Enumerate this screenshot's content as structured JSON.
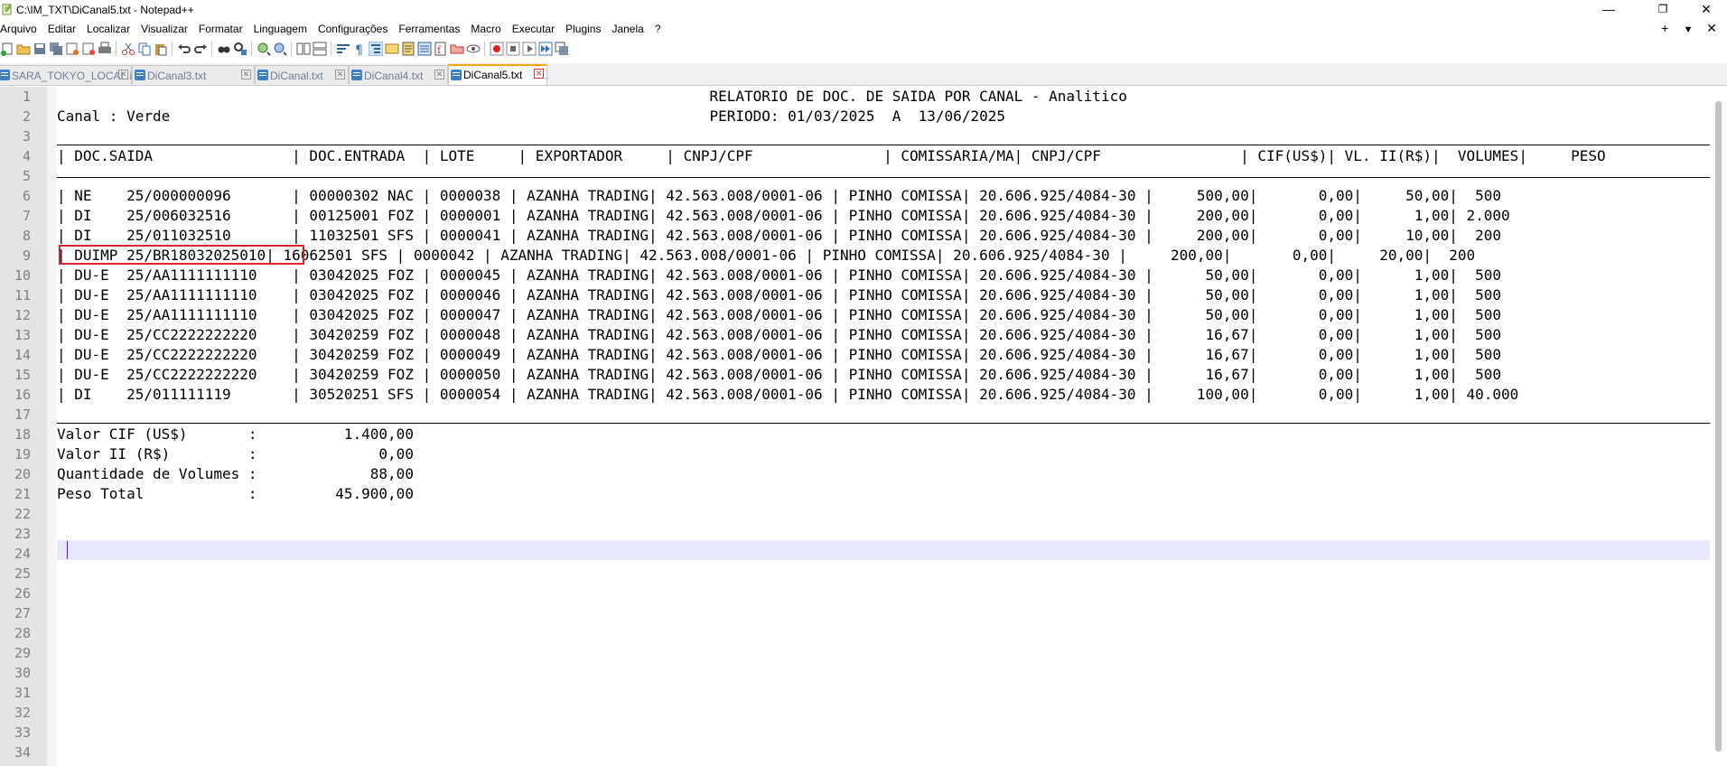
{
  "window": {
    "title": "C:\\IM_TXT\\DiCanal5.txt - Notepad++",
    "minimize": "—",
    "restore": "❐",
    "close": "✕"
  },
  "menu": {
    "items": [
      "Arquivo",
      "Editar",
      "Localizar",
      "Visualizar",
      "Formatar",
      "Linguagem",
      "Configurações",
      "Ferramentas",
      "Macro",
      "Executar",
      "Plugins",
      "Janela",
      "?"
    ],
    "right": [
      "+",
      "▼",
      "✕"
    ]
  },
  "tabs": [
    {
      "label": "SARA_TOKYO_LOCAL.ini",
      "active": false
    },
    {
      "label": "DiCanal3.txt",
      "active": false
    },
    {
      "label": "DiCanal.txt",
      "active": false
    },
    {
      "label": "DiCanal4.txt",
      "active": false
    },
    {
      "label": "DiCanal5.txt",
      "active": true
    }
  ],
  "editor": {
    "line_numbers": [
      "1",
      "2",
      "3",
      "4",
      "5",
      "6",
      "7",
      "8",
      "9",
      "10",
      "11",
      "12",
      "13",
      "14",
      "15",
      "16",
      "17",
      "18",
      "19",
      "20",
      "21",
      "22",
      "23",
      "24",
      "25",
      "26",
      "27",
      "28",
      "29",
      "30",
      "31",
      "32",
      "33",
      "34"
    ],
    "lines": [
      "                                                                           RELATORIO DE DOC. DE SAIDA POR CANAL - Analitico",
      "Canal : Verde                                                              PERIODO: 01/03/2025  A  13/06/2025",
      "",
      "| DOC.SAIDA                | DOC.ENTRADA  | LOTE     | EXPORTADOR     | CNPJ/CPF               | COMISSARIA/MA| CNPJ/CPF                | CIF(US$)| VL. II(R$)|  VOLUMES|     PESO",
      "",
      "| NE    25/000000096       | 00000302 NAC | 0000038 | AZANHA TRADING| 42.563.008/0001-06 | PINHO COMISSA| 20.606.925/4084-30 |     500,00|       0,00|     50,00|  500",
      "| DI    25/006032516       | 00125001 FOZ | 0000001 | AZANHA TRADING| 42.563.008/0001-06 | PINHO COMISSA| 20.606.925/4084-30 |     200,00|       0,00|      1,00| 2.000",
      "| DI    25/011032510       | 11032501 SFS | 0000041 | AZANHA TRADING| 42.563.008/0001-06 | PINHO COMISSA| 20.606.925/4084-30 |     200,00|       0,00|     10,00|  200",
      "| DUIMP 25/BR18032025010| 16062501 SFS | 0000042 | AZANHA TRADING| 42.563.008/0001-06 | PINHO COMISSA| 20.606.925/4084-30 |     200,00|       0,00|     20,00|  200",
      "| DU-E  25/AA1111111110    | 03042025 FOZ | 0000045 | AZANHA TRADING| 42.563.008/0001-06 | PINHO COMISSA| 20.606.925/4084-30 |      50,00|       0,00|      1,00|  500",
      "| DU-E  25/AA1111111110    | 03042025 FOZ | 0000046 | AZANHA TRADING| 42.563.008/0001-06 | PINHO COMISSA| 20.606.925/4084-30 |      50,00|       0,00|      1,00|  500",
      "| DU-E  25/AA1111111110    | 03042025 FOZ | 0000047 | AZANHA TRADING| 42.563.008/0001-06 | PINHO COMISSA| 20.606.925/4084-30 |      50,00|       0,00|      1,00|  500",
      "| DU-E  25/CC2222222220    | 30420259 FOZ | 0000048 | AZANHA TRADING| 42.563.008/0001-06 | PINHO COMISSA| 20.606.925/4084-30 |      16,67|       0,00|      1,00|  500",
      "| DU-E  25/CC2222222220    | 30420259 FOZ | 0000049 | AZANHA TRADING| 42.563.008/0001-06 | PINHO COMISSA| 20.606.925/4084-30 |      16,67|       0,00|      1,00|  500",
      "| DU-E  25/CC2222222220    | 30420259 FOZ | 0000050 | AZANHA TRADING| 42.563.008/0001-06 | PINHO COMISSA| 20.606.925/4084-30 |      16,67|       0,00|      1,00|  500",
      "| DI    25/011111119       | 30520251 SFS | 0000054 | AZANHA TRADING| 42.563.008/0001-06 | PINHO COMISSA| 20.606.925/4084-30 |     100,00|       0,00|      1,00| 40.000",
      "",
      "Valor CIF (US$)       :          1.400,00",
      "Valor II (R$)         :              0,00",
      "Quantidade de Volumes :             88,00",
      "Peso Total            :         45.900,00",
      "",
      "",
      "",
      "",
      "",
      "",
      "",
      "",
      "",
      "",
      "",
      "",
      ""
    ]
  }
}
